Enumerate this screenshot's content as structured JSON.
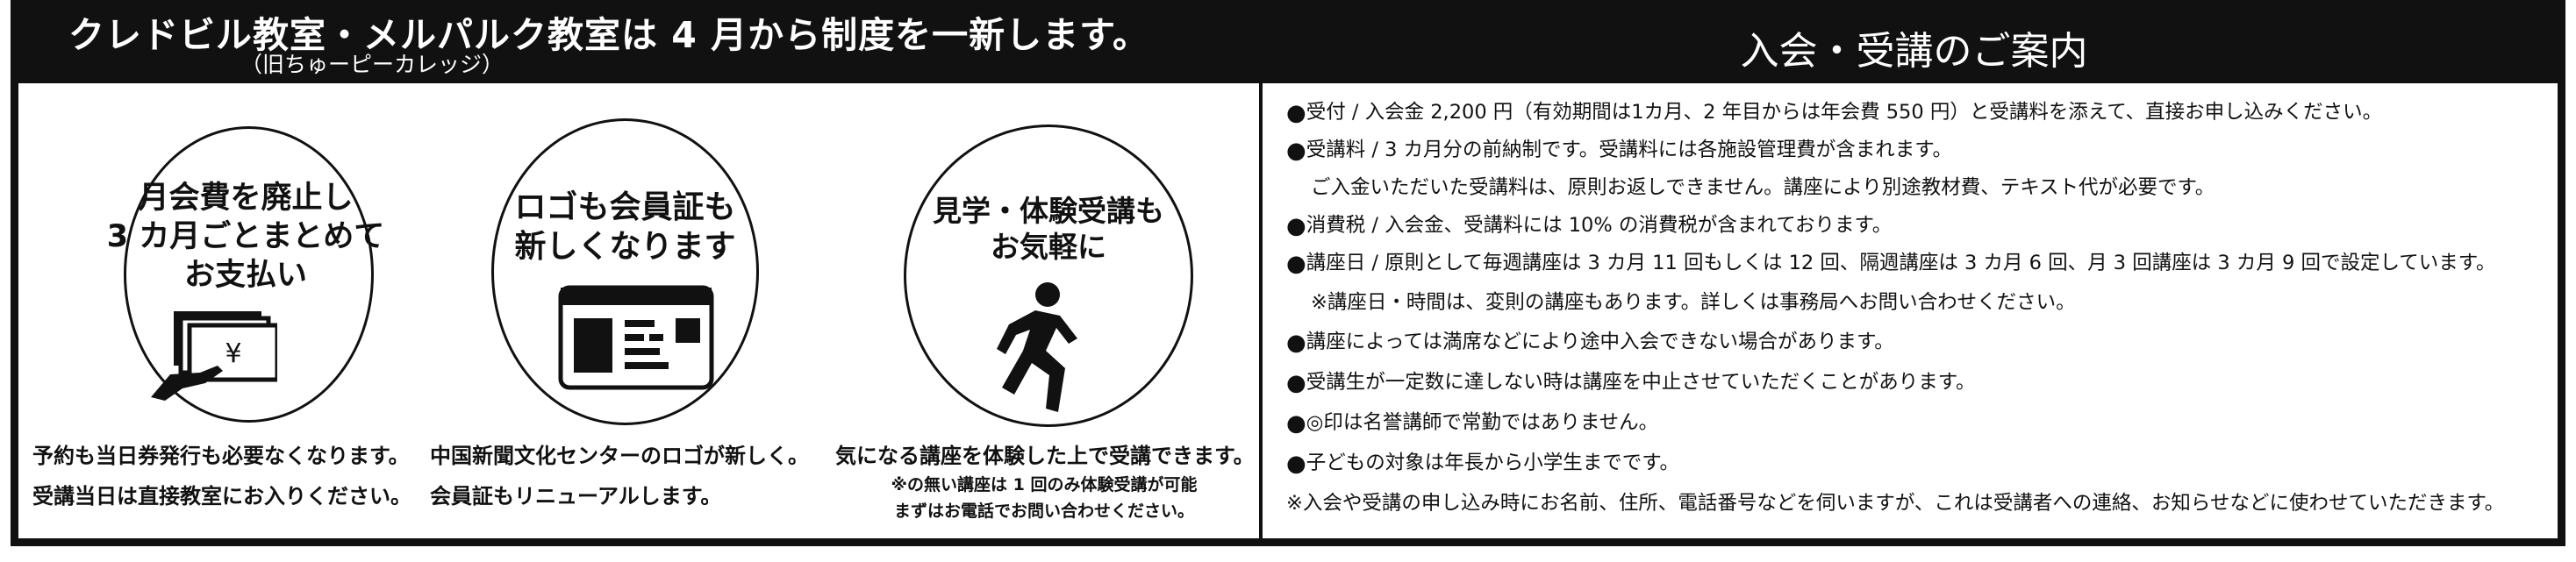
{
  "left": {
    "title": "クレドビル教室・メルパルク教室は 4 月から制度を一新します。",
    "subtitle": "（旧ちゅーピーカレッジ）",
    "features": [
      {
        "circle_text": "月会費を廃止し\n3 カ月ごとまとめて\nお支払い",
        "icon": "yen-payment-hand-icon",
        "lines": [
          "予約も当日券発行も必要なくなります。",
          "受講当日は直接教室にお入りください。"
        ]
      },
      {
        "circle_text": "ロゴも会員証も\n新しくなります",
        "icon": "membership-card-icon",
        "lines": [
          "中国新聞文化センターのロゴが新しく。",
          "会員証もリニューアルします。"
        ]
      },
      {
        "circle_text": "見学・体験受講も\nお気軽に",
        "icon": "running-person-icon",
        "lines": [
          "気になる講座を体験した上で受講できます。"
        ],
        "notes": [
          "※の無い講座は 1 回のみ体験受講が可能",
          "まずはお電話でお問い合わせください。"
        ]
      }
    ],
    "yen_symbol": "¥"
  },
  "right": {
    "title": "入会・受講のご案内",
    "items": [
      {
        "bullet": "●",
        "text": "受付 / 入会金 2,200 円（有効期間は1カ月、2 年目からは年会費 550 円）と受講料を添えて、直接お申し込みください。"
      },
      {
        "bullet": "●",
        "text": "受講料 / 3 カ月分の前納制です。受講料には各施設管理費が含まれます。"
      },
      {
        "bullet": "",
        "text": "ご入金いただいた受講料は、原則お返しできません。講座により別途教材費、テキスト代が必要です。"
      },
      {
        "bullet": "●",
        "text": "消費税 / 入会金、受講料には 10% の消費税が含まれております。"
      },
      {
        "bullet": "●",
        "text": "講座日 / 原則として毎週講座は 3 カ月 11 回もしくは 12 回、隔週講座は 3 カ月 6 回、月 3 回講座は 3 カ月 9 回で設定しています。"
      },
      {
        "bullet": "",
        "text": "※講座日・時間は、変則の講座もあります。詳しくは事務局へお問い合わせください。"
      },
      {
        "bullet": "●",
        "text": "講座によっては満席などにより途中入会できない場合があります。"
      },
      {
        "bullet": "●",
        "text": "受講生が一定数に達しない時は講座を中止させていただくことがあります。"
      },
      {
        "bullet": "●",
        "text": "◎印は名誉講師で常勤ではありません。"
      },
      {
        "bullet": "●",
        "text": "子どもの対象は年長から小学生までです。"
      },
      {
        "bullet": "",
        "text": "※入会や受講の申し込み時にお名前、住所、電話番号などを伺いますが、これは受講者への連絡、お知らせなどに使わせていただきます。"
      }
    ]
  },
  "colors": {
    "ink": "#111111",
    "paper": "#ffffff"
  }
}
